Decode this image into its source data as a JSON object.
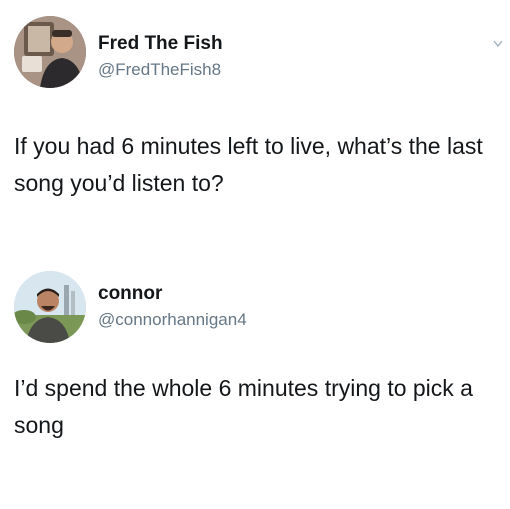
{
  "tweets": [
    {
      "name": "Fred The Fish",
      "handle": "@FredTheFish8",
      "text": "If you had 6 minutes left to live, what’s the last song you’d listen to?",
      "avatar": "person-photo-avatar"
    },
    {
      "name": "connor",
      "handle": "@connorhannigan4",
      "text": "I’d spend the whole 6 minutes trying to pick a song",
      "avatar": "smiling-man-photo-avatar"
    }
  ],
  "icons": {
    "more_menu": "chevron-down-icon"
  },
  "colors": {
    "text": "#14171a",
    "handle": "#657786",
    "background": "#ffffff"
  }
}
